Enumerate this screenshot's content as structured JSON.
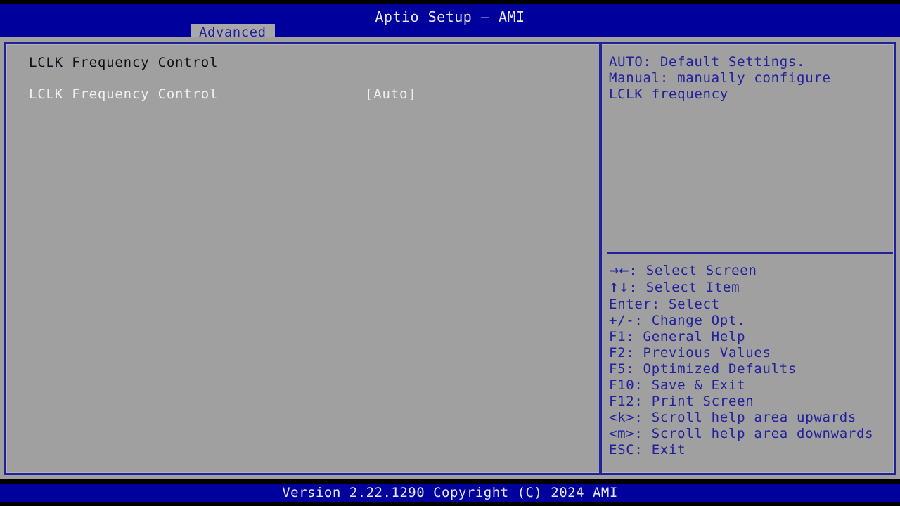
{
  "app": {
    "title": "Aptio Setup – AMI",
    "accent_blue": "#00009c",
    "panel_border": "#21219c",
    "background_gray": "#a0a0a0",
    "text_white": "#f0f0f0"
  },
  "tabs": [
    {
      "label": "Advanced",
      "active": true
    }
  ],
  "main": {
    "section_heading": "LCLK Frequency Control",
    "items": [
      {
        "label": "LCLK Frequency Control",
        "value": "[Auto]",
        "selected": false
      }
    ]
  },
  "help": {
    "lines": [
      "AUTO: Default Settings.",
      "Manual: manually configure",
      "LCLK frequency"
    ]
  },
  "legend": [
    {
      "key": "→←",
      "key_is_glyph": true,
      "text": ": Select Screen"
    },
    {
      "key": "↑↓",
      "key_is_glyph": true,
      "text": ": Select Item"
    },
    {
      "key": "Enter",
      "key_is_glyph": false,
      "text": ": Select"
    },
    {
      "key": "+/-",
      "key_is_glyph": false,
      "text": ": Change Opt."
    },
    {
      "key": "F1",
      "key_is_glyph": false,
      "text": ": General Help"
    },
    {
      "key": "F2",
      "key_is_glyph": false,
      "text": ": Previous Values"
    },
    {
      "key": "F5",
      "key_is_glyph": false,
      "text": ": Optimized Defaults"
    },
    {
      "key": "F10",
      "key_is_glyph": false,
      "text": ": Save & Exit"
    },
    {
      "key": "F12",
      "key_is_glyph": false,
      "text": ": Print Screen"
    },
    {
      "key": "<k>",
      "key_is_glyph": false,
      "text": ": Scroll help area upwards"
    },
    {
      "key": "<m>",
      "key_is_glyph": false,
      "text": ": Scroll help area downwards"
    },
    {
      "key": "ESC",
      "key_is_glyph": false,
      "text": ": Exit"
    }
  ],
  "footer": {
    "version_text": "Version 2.22.1290 Copyright (C) 2024 AMI"
  }
}
